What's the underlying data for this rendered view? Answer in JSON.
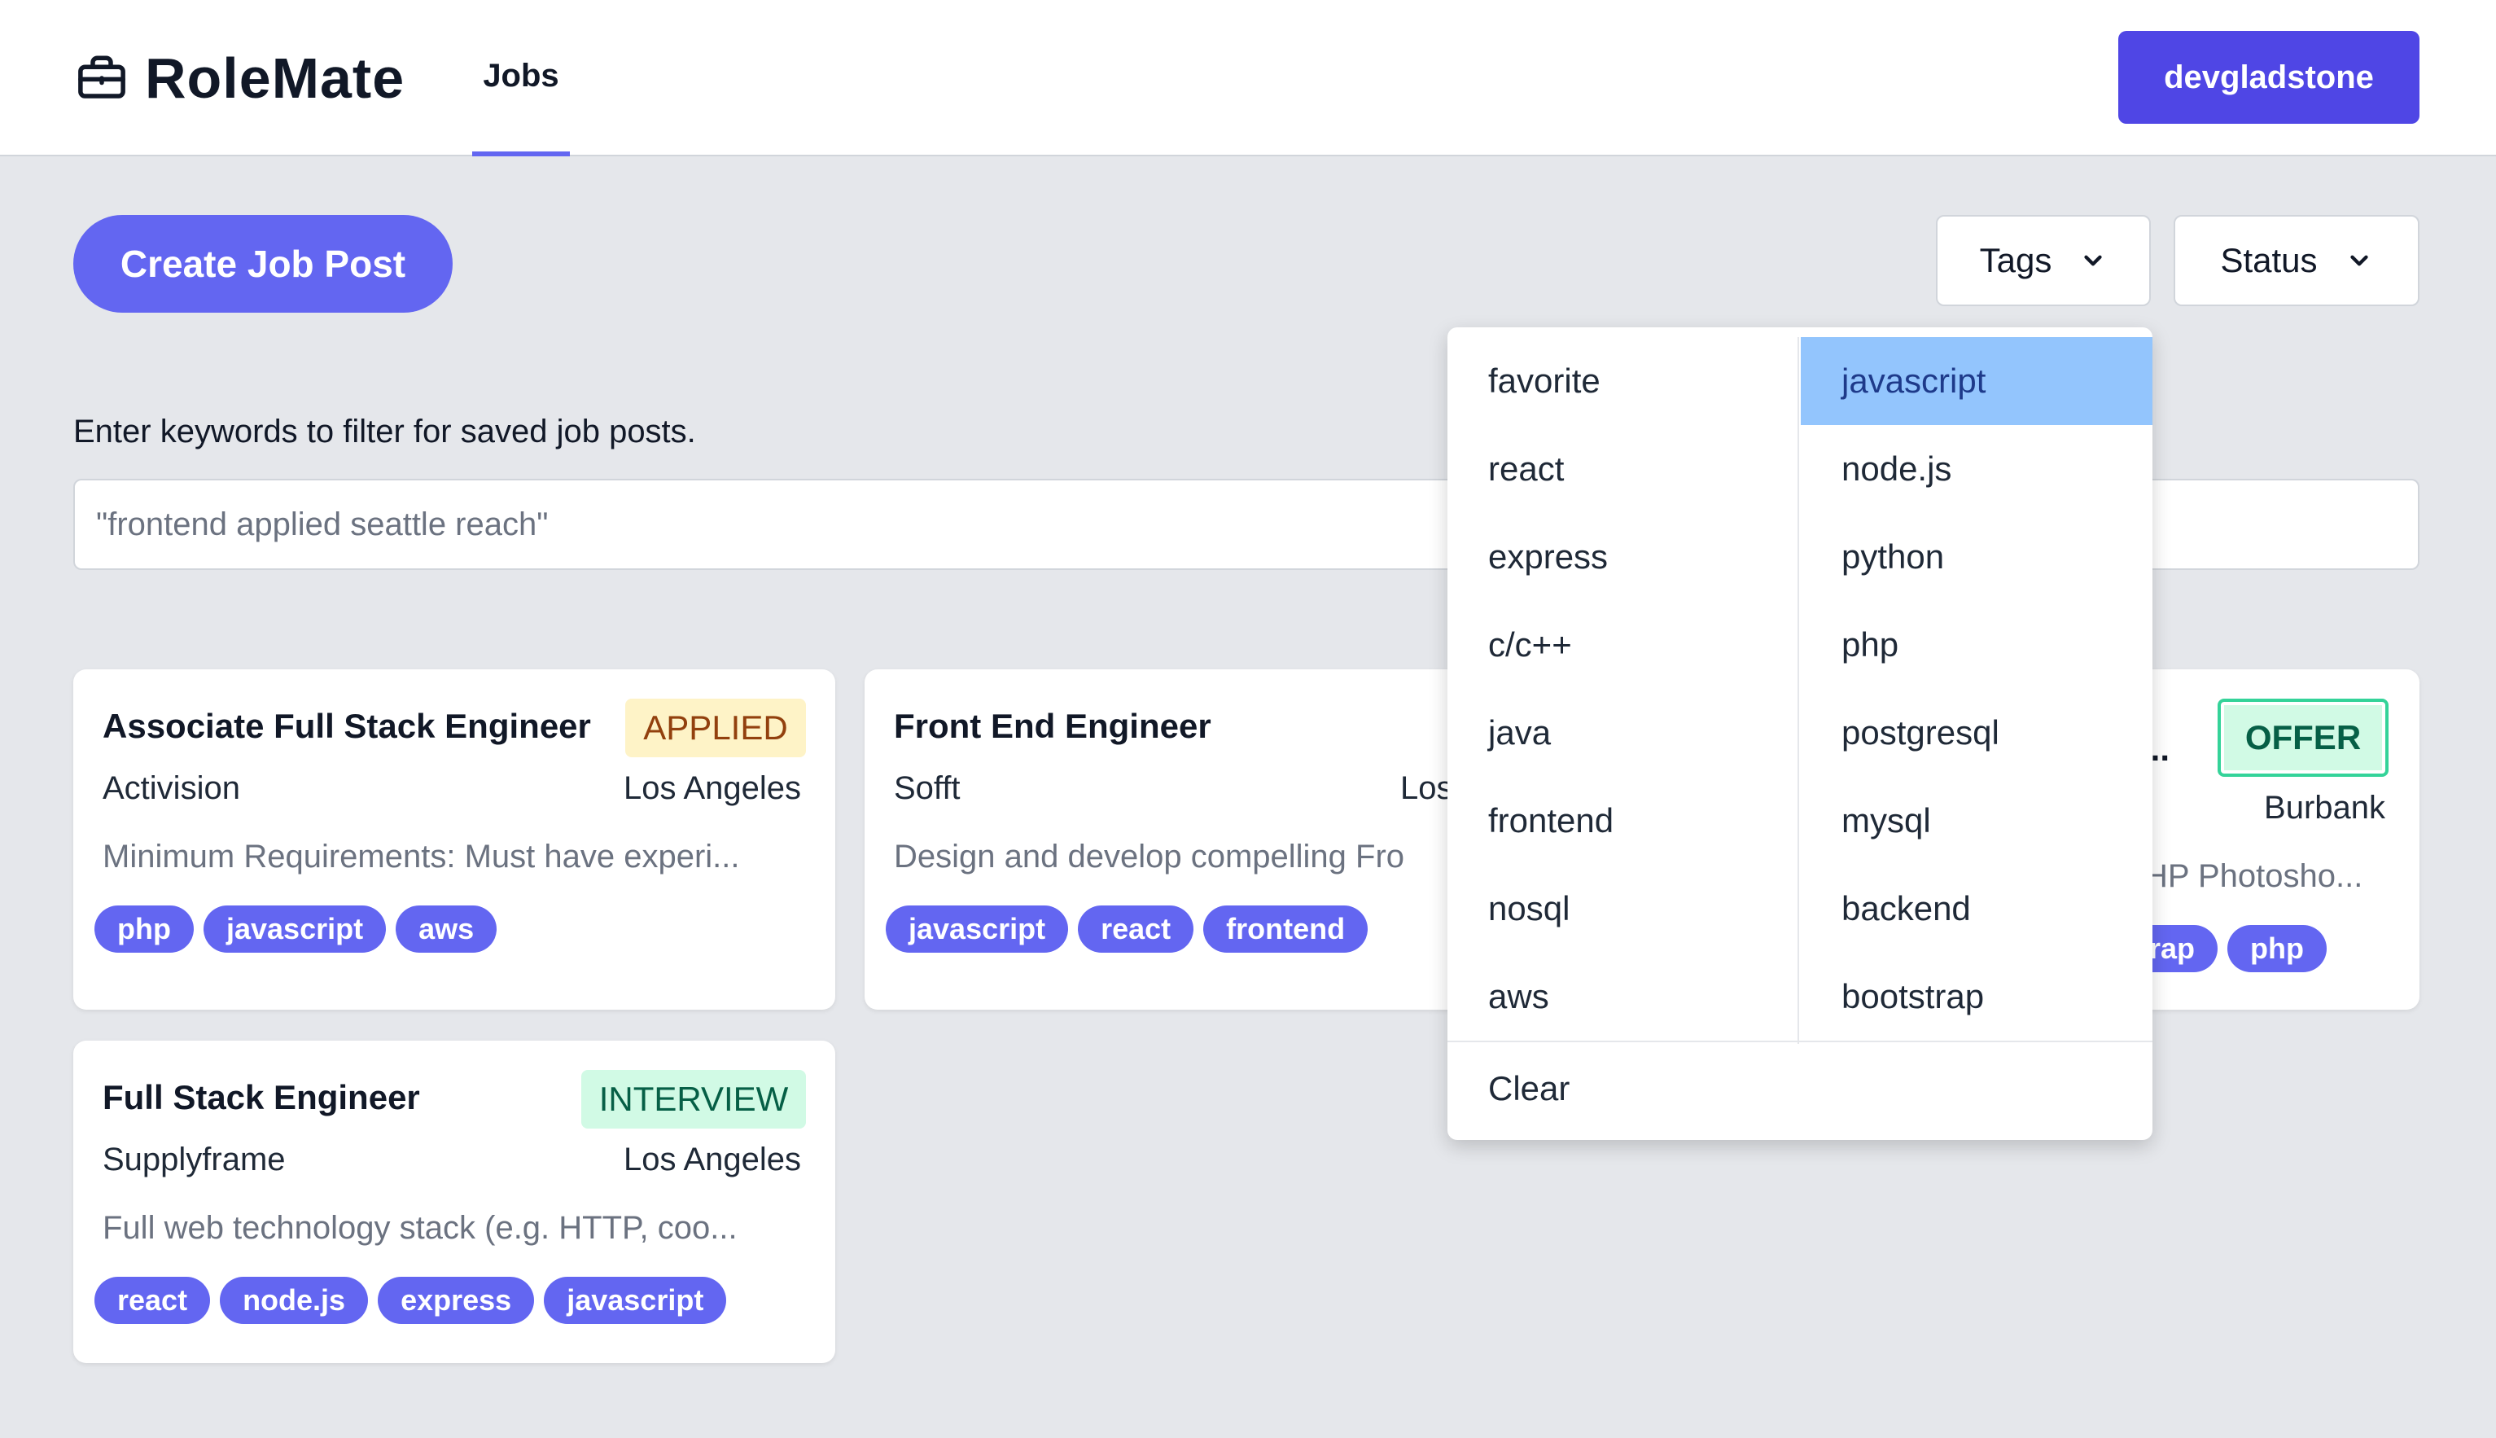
{
  "app": {
    "name": "RoleMate",
    "brand_icon": "briefcase-icon"
  },
  "nav": {
    "jobs_label": "Jobs"
  },
  "user": {
    "username": "devgladstone"
  },
  "actions": {
    "create_label": "Create Job Post"
  },
  "filters": {
    "tags_label": "Tags",
    "status_label": "Status"
  },
  "search": {
    "hint": "Enter keywords to filter for saved job posts.",
    "placeholder": "\"frontend applied seattle reach\""
  },
  "cards": [
    {
      "title": "Associate Full Stack Engineer",
      "status": "APPLIED",
      "company": "Activision",
      "location": "Los Angeles",
      "description": "Minimum Requirements: Must have experi...",
      "tags": [
        "php",
        "javascript",
        "aws"
      ]
    },
    {
      "title": "Front End Engineer",
      "company": "Sofft",
      "location": "Los",
      "description": "Design and develop compelling Fro",
      "tags": [
        "javascript",
        "react",
        "frontend"
      ]
    },
    {
      "title": "...",
      "status": "OFFER",
      "location": "Burbank",
      "description": "HP Photosho...",
      "tags": [
        "trap",
        "php"
      ]
    },
    {
      "title": "Full Stack Engineer",
      "status": "INTERVIEW",
      "company": "Supplyframe",
      "location": "Los Angeles",
      "description": "Full web technology stack (e.g. HTTP, coo...",
      "tags": [
        "react",
        "node.js",
        "express",
        "javascript"
      ]
    }
  ],
  "tags_dropdown": {
    "left": [
      "favorite",
      "react",
      "express",
      "c/c++",
      "java",
      "frontend",
      "nosql",
      "aws"
    ],
    "right": [
      "javascript",
      "node.js",
      "python",
      "php",
      "postgresql",
      "mysql",
      "backend",
      "bootstrap"
    ],
    "selected": "javascript",
    "clear_label": "Clear"
  },
  "colors": {
    "accent": "#6366f1",
    "user_button": "#4f46e5",
    "applied_bg": "#fef3c7",
    "interview_bg": "#d1fae5",
    "selected_item": "#93c5fd"
  }
}
